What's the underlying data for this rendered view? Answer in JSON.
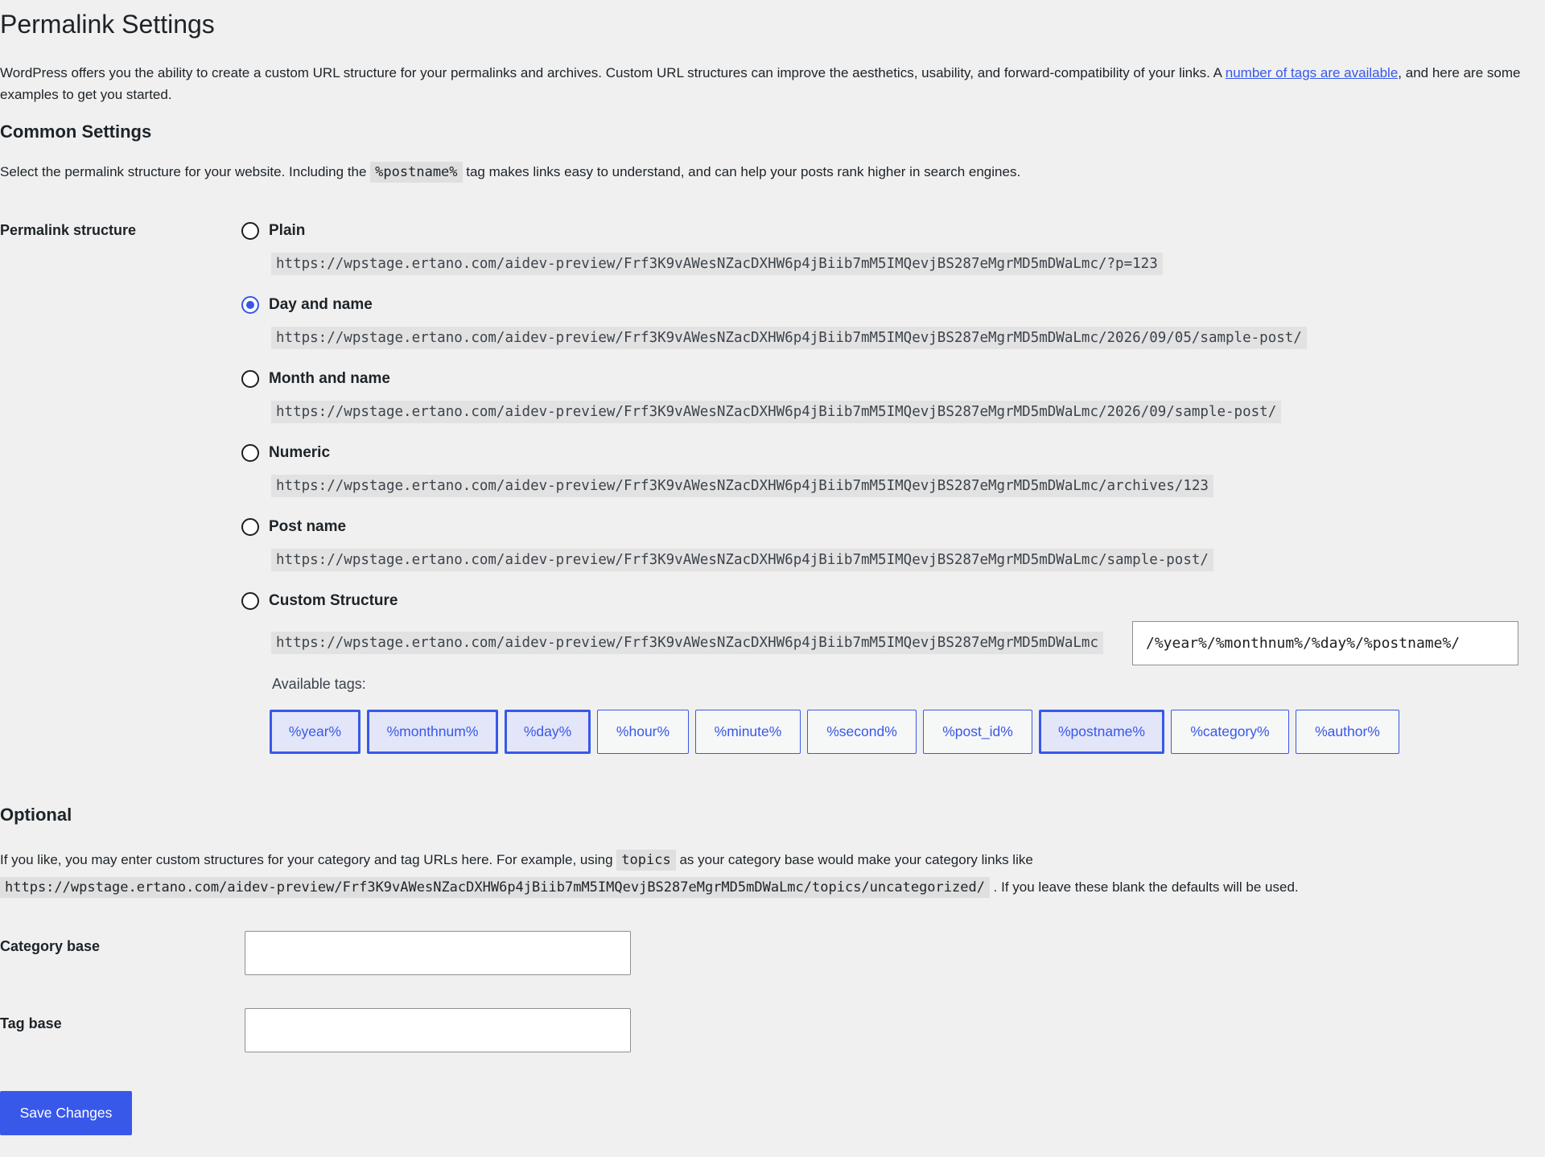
{
  "page": {
    "title": "Permalink Settings",
    "intro_before_link": "WordPress offers you the ability to create a custom URL structure for your permalinks and archives. Custom URL structures can improve the aesthetics, usability, and forward-compatibility of your links. A ",
    "intro_link": "number of tags are available",
    "intro_after_link": ", and here are some examples to get you started."
  },
  "common": {
    "heading": "Common Settings",
    "desc_before": "Select the permalink structure for your website. Including the ",
    "desc_code": "%postname%",
    "desc_after": " tag makes links easy to understand, and can help your posts rank higher in search engines.",
    "field_label": "Permalink structure",
    "options": [
      {
        "label": "Plain",
        "url": "https://wpstage.ertano.com/aidev-preview/Frf3K9vAWesNZacDXHW6p4jBiib7mM5IMQevjBS287eMgrMD5mDWaLmc/?p=123",
        "checked": false
      },
      {
        "label": "Day and name",
        "url": "https://wpstage.ertano.com/aidev-preview/Frf3K9vAWesNZacDXHW6p4jBiib7mM5IMQevjBS287eMgrMD5mDWaLmc/2026/09/05/sample-post/",
        "checked": true
      },
      {
        "label": "Month and name",
        "url": "https://wpstage.ertano.com/aidev-preview/Frf3K9vAWesNZacDXHW6p4jBiib7mM5IMQevjBS287eMgrMD5mDWaLmc/2026/09/sample-post/",
        "checked": false
      },
      {
        "label": "Numeric",
        "url": "https://wpstage.ertano.com/aidev-preview/Frf3K9vAWesNZacDXHW6p4jBiib7mM5IMQevjBS287eMgrMD5mDWaLmc/archives/123",
        "checked": false
      },
      {
        "label": "Post name",
        "url": "https://wpstage.ertano.com/aidev-preview/Frf3K9vAWesNZacDXHW6p4jBiib7mM5IMQevjBS287eMgrMD5mDWaLmc/sample-post/",
        "checked": false
      },
      {
        "label": "Custom Structure",
        "url": "https://wpstage.ertano.com/aidev-preview/Frf3K9vAWesNZacDXHW6p4jBiib7mM5IMQevjBS287eMgrMD5mDWaLmc",
        "checked": false
      }
    ],
    "custom_value": "/%year%/%monthnum%/%day%/%postname%/",
    "available_tags_label": "Available tags:",
    "tags": [
      {
        "label": "%year%",
        "active": true
      },
      {
        "label": "%monthnum%",
        "active": true
      },
      {
        "label": "%day%",
        "active": true
      },
      {
        "label": "%hour%",
        "active": false
      },
      {
        "label": "%minute%",
        "active": false
      },
      {
        "label": "%second%",
        "active": false
      },
      {
        "label": "%post_id%",
        "active": false
      },
      {
        "label": "%postname%",
        "active": true
      },
      {
        "label": "%category%",
        "active": false
      },
      {
        "label": "%author%",
        "active": false
      }
    ]
  },
  "optional": {
    "heading": "Optional",
    "desc_before": "If you like, you may enter custom structures for your category and tag URLs here. For example, using ",
    "desc_code": "topics",
    "desc_middle": " as your category base would make your category links like ",
    "desc_url": "https://wpstage.ertano.com/aidev-preview/Frf3K9vAWesNZacDXHW6p4jBiib7mM5IMQevjBS287eMgrMD5mDWaLmc/topics/uncategorized/",
    "desc_after": " . If you leave these blank the defaults will be used.",
    "category_label": "Category base",
    "category_value": "",
    "tag_label": "Tag base",
    "tag_value": ""
  },
  "actions": {
    "save_label": "Save Changes"
  },
  "colors": {
    "accent": "#3858e9",
    "background": "#f0f0f1",
    "text": "#1d2327",
    "link": "#3858e9"
  }
}
